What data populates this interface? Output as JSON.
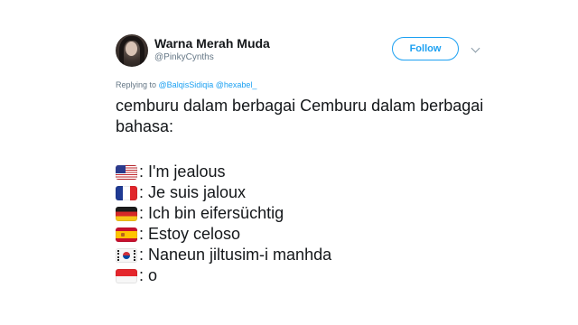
{
  "author": {
    "display_name": "Warna Merah Muda",
    "handle": "@PinkyCynths"
  },
  "follow_label": "Follow",
  "replying": {
    "prefix": "Replying to",
    "mention_1": "@BalqisSidiqia",
    "mention_2": "@hexabel_"
  },
  "tweet": {
    "text": "cemburu dalam berbagai Cemburu dalam berbagai bahasa:",
    "lines": [
      {
        "flag": "us-flag-icon",
        "text": ": I'm jealous"
      },
      {
        "flag": "france-flag-icon",
        "text": ": Je suis jaloux"
      },
      {
        "flag": "germany-flag-icon",
        "text": ": Ich bin eifersüchtig"
      },
      {
        "flag": "spain-flag-icon",
        "text": ": Estoy celoso"
      },
      {
        "flag": "south-korea-flag-icon",
        "text": ": Naneun jiltusim-i manhda"
      },
      {
        "flag": "indonesia-flag-icon",
        "text": ": o"
      }
    ]
  },
  "colors": {
    "accent": "#1da1f2",
    "text": "#14171a",
    "muted": "#657786"
  }
}
